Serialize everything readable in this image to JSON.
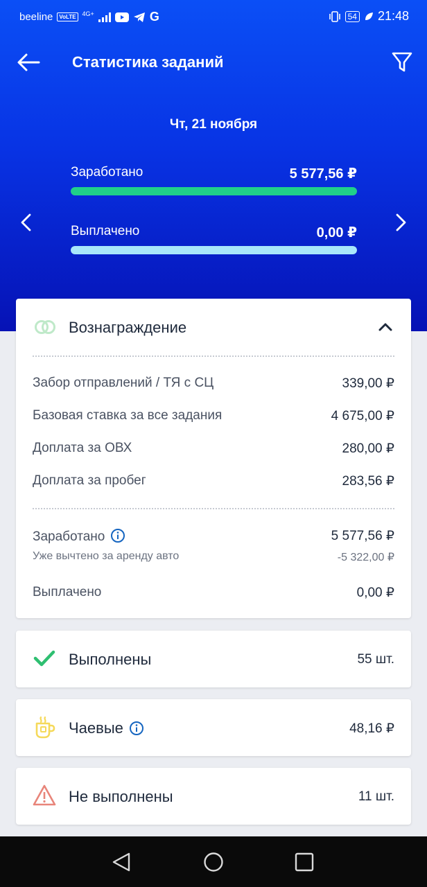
{
  "status_bar": {
    "carrier": "beeline",
    "volte": "VoLTE",
    "network": "4G+",
    "battery": "54",
    "time": "21:48"
  },
  "header": {
    "title": "Статистика заданий",
    "back_icon": "arrow-left-icon",
    "filter_icon": "filter-icon"
  },
  "summary": {
    "date": "Чт, 21 ноября",
    "earned_label": "Заработано",
    "earned_value": "5 577,56 ₽",
    "earned_fill": 1.0,
    "paid_label": "Выплачено",
    "paid_value": "0,00 ₽",
    "paid_fill": 1.0
  },
  "reward": {
    "title": "Вознаграждение",
    "items": [
      {
        "label": "Забор отправлений / ТЯ с СЦ",
        "value": "339,00 ₽"
      },
      {
        "label": "Базовая ставка за все задания",
        "value": "4 675,00 ₽"
      },
      {
        "label": "Доплата за ОВХ",
        "value": "280,00 ₽"
      },
      {
        "label": "Доплата за пробег",
        "value": "283,56 ₽"
      }
    ],
    "earned_label": "Заработано",
    "earned_value": "5 577,56 ₽",
    "rent_label": "Уже вычтено за аренду авто",
    "rent_value": "-5 322,00 ₽",
    "paid_label": "Выплачено",
    "paid_value": "0,00 ₽"
  },
  "completed": {
    "label": "Выполнены",
    "value": "55 шт."
  },
  "tips": {
    "label": "Чаевые",
    "value": "48,16 ₽"
  },
  "failed": {
    "label": "Не выполнены",
    "value": "11 шт."
  },
  "colors": {
    "accent": "#0b4ff6",
    "earned_bar": "#20d08a",
    "paid_bar": "#a9e7fb",
    "check": "#2fbf71",
    "warning": "#e8857a",
    "info": "#1565c0"
  }
}
